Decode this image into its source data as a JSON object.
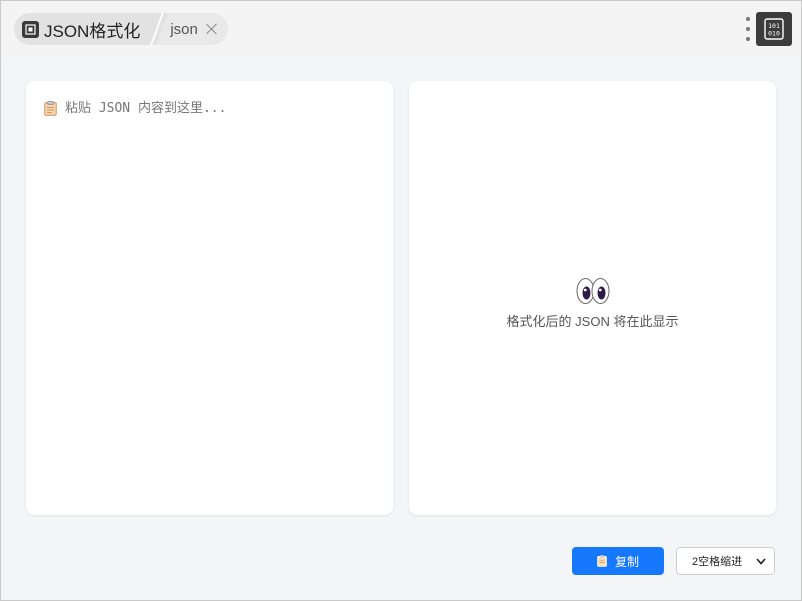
{
  "header": {
    "app_title": "JSON格式化",
    "tab_label": "json"
  },
  "input_panel": {
    "placeholder": "粘贴 JSON 内容到这里..."
  },
  "output_panel": {
    "empty_text": "格式化后的 JSON 将在此显示"
  },
  "footer": {
    "copy_label": "复制",
    "indent_selected": "2空格缩进"
  },
  "colors": {
    "accent": "#1677ff",
    "logo_bg": "#3c3c3c"
  },
  "icons": {
    "app": "app-icon",
    "tab_close": "close-icon",
    "more": "more-vertical-icon",
    "logo": "binary-icon",
    "clipboard": "clipboard-icon",
    "eyes": "eyes-icon",
    "dropdown": "chevron-down-icon"
  }
}
